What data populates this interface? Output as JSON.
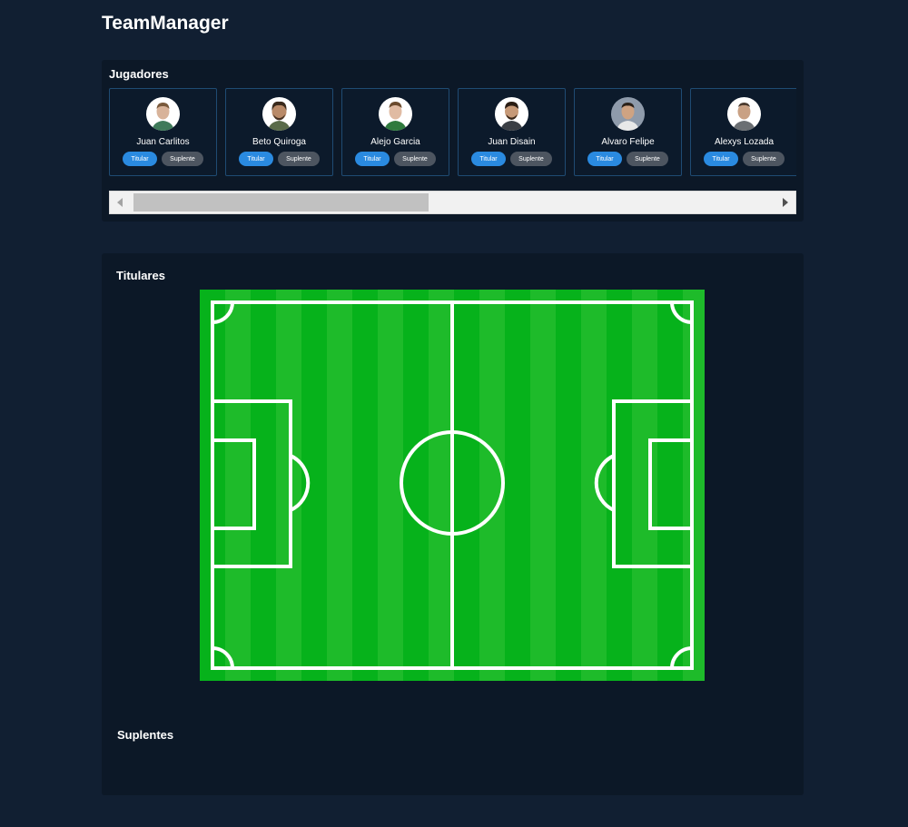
{
  "app": {
    "title": "TeamManager"
  },
  "players_section": {
    "title": "Jugadores",
    "players": [
      {
        "name": "Juan Carlitos",
        "titular_label": "Titular",
        "suplente_label": "Suplente",
        "avatar_bg": "#ffffff"
      },
      {
        "name": "Beto Quiroga",
        "titular_label": "Titular",
        "suplente_label": "Suplente",
        "avatar_bg": "#ffffff"
      },
      {
        "name": "Alejo Garcia",
        "titular_label": "Titular",
        "suplente_label": "Suplente",
        "avatar_bg": "#ffffff"
      },
      {
        "name": "Juan Disain",
        "titular_label": "Titular",
        "suplente_label": "Suplente",
        "avatar_bg": "#ffffff"
      },
      {
        "name": "Alvaro Felipe",
        "titular_label": "Titular",
        "suplente_label": "Suplente",
        "avatar_bg": "#8f9bab"
      },
      {
        "name": "Alexys Lozada",
        "titular_label": "Titular",
        "suplente_label": "Suplente",
        "avatar_bg": "#ffffff"
      }
    ],
    "scroll_position": 0
  },
  "lineup": {
    "starters_title": "Titulares",
    "subs_title": "Suplentes"
  },
  "icons": {
    "scroll_left": "triangle-left-icon",
    "scroll_right": "triangle-right-icon",
    "player_avatar": "player-photo-icon"
  },
  "colors": {
    "background": "#111f32",
    "panel": "#0c1827",
    "card_border": "#1f4b73",
    "titular_button": "#2a8ae0",
    "suplente_button": "#4d5560",
    "pitch_green": "#06b21b",
    "pitch_stripe": "#2fbf2e"
  }
}
